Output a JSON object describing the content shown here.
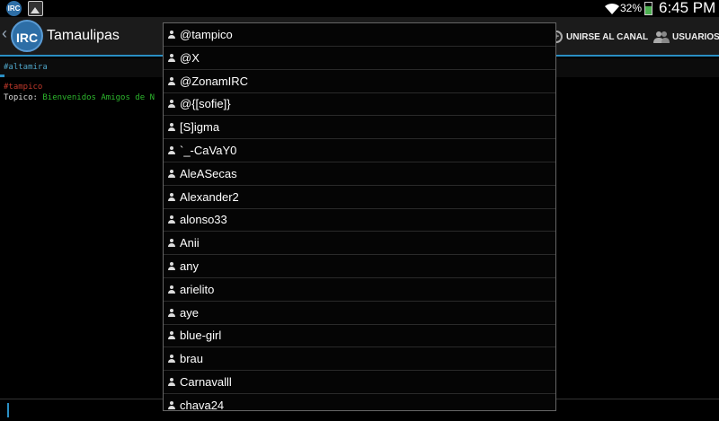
{
  "status_bar": {
    "app_icon": "irc-app-icon",
    "app_icon_text": "IRC",
    "gallery_icon": "image-icon",
    "battery": "32%",
    "time": "6:45 PM"
  },
  "action_bar": {
    "logo_text": "IRC",
    "title": "Tamaulipas",
    "join_label": "UNIRSE AL CANAL",
    "join_icon": "plus-circle-icon",
    "users_label": "USUARIOS",
    "users_icon": "users-icon"
  },
  "tabs": {
    "active": "#altamira"
  },
  "messages": {
    "channel": "#tampico",
    "topic_label": "Topico:",
    "topic_text": "Bienvenidos Amigos de N"
  },
  "user_list": {
    "users": [
      "@tampico",
      "@X",
      "@ZonamIRC",
      "@{[sofie]}",
      "[S]igma",
      "`_-CaVaY0",
      "AleASecas",
      "Alexander2",
      "alonso33",
      "Anii",
      "any",
      "arielito",
      "aye",
      "blue-girl",
      "brau",
      "Carnavalll",
      "chava24"
    ]
  },
  "colors": {
    "accent": "#2a8fc4",
    "channel_red": "#c0392b",
    "topic_green": "#2db82d"
  }
}
